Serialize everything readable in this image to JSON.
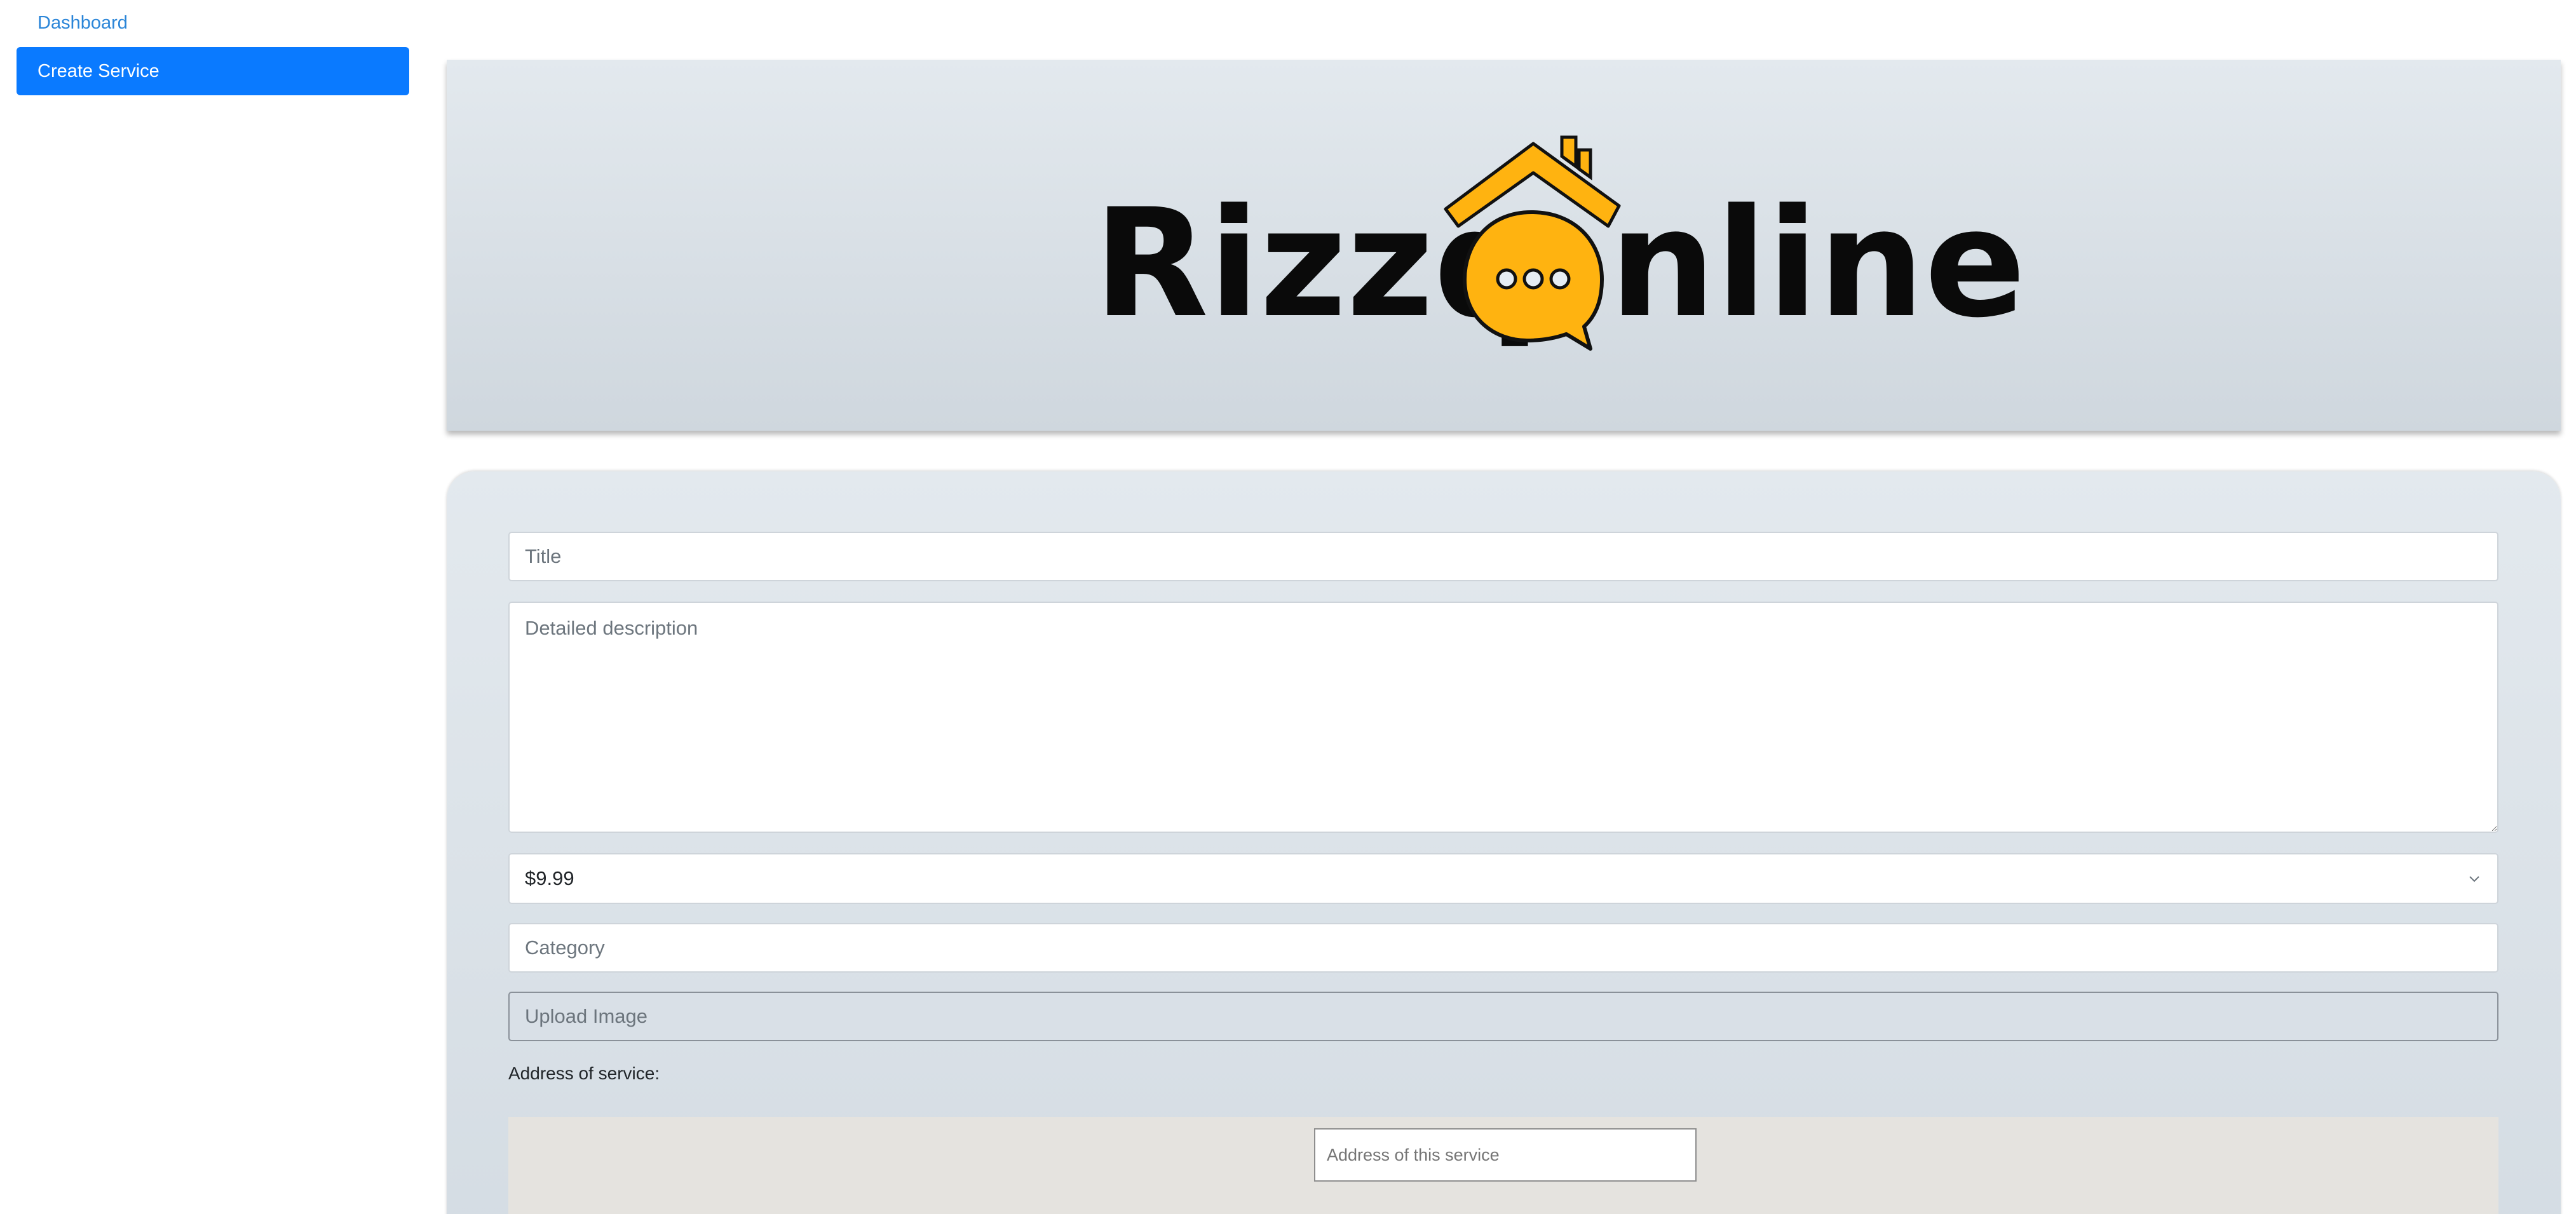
{
  "sidebar": {
    "items": [
      {
        "label": "Dashboard",
        "active": false
      },
      {
        "label": "Create Service",
        "active": true
      }
    ]
  },
  "banner": {
    "logo_text_left": "Rizzq",
    "logo_text_right": "nline",
    "logo_icon": "house-chat-bubble-icon",
    "colors": {
      "accent": "#ffb310",
      "text": "#0a0a0a"
    }
  },
  "form": {
    "title": {
      "placeholder": "Title",
      "value": ""
    },
    "description": {
      "placeholder": "Detailed description",
      "value": ""
    },
    "price": {
      "selected": "$9.99"
    },
    "category": {
      "placeholder": "Category",
      "value": ""
    },
    "upload": {
      "label": "Upload Image"
    },
    "address_label": "Address of service:",
    "address_input": {
      "placeholder": "Address of this service",
      "value": ""
    }
  },
  "colors": {
    "primary": "#0a7aff",
    "link": "#2a85d8",
    "card_bg": "#e3e9ee"
  }
}
